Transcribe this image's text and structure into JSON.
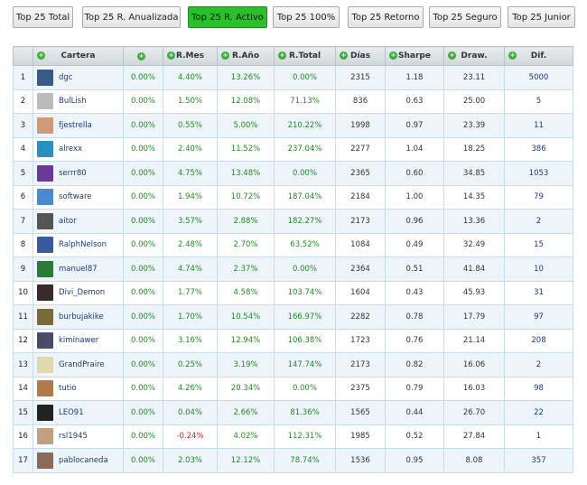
{
  "tabs": [
    {
      "label": "Top 25 Total",
      "active": false
    },
    {
      "label": "Top 25 R. Anualizada",
      "active": false
    },
    {
      "label": "Top 25 R. Activo",
      "active": true
    },
    {
      "label": "Top 25 100%",
      "active": false
    },
    {
      "label": "Top 25 Retorno",
      "active": false
    },
    {
      "label": "Top 25 Seguro",
      "active": false
    },
    {
      "label": "Top 25 Junior",
      "active": false
    }
  ],
  "table": {
    "headers": [
      "",
      "Cartera",
      "",
      "R.Mes",
      "R.Año",
      "R.Total",
      "Días",
      "Sharpe",
      "Draw.",
      "Dif."
    ],
    "sort_icon": "circle-plus-icon",
    "rows": [
      {
        "rank": "1",
        "name": "dgc",
        "c1": "0.00%",
        "rmes": "4.40%",
        "rano": "13.26%",
        "rtotal": "0.00%",
        "dias": "2315",
        "sharpe": "1.18",
        "draw": "23.11",
        "dif": "5000",
        "avatar": "#3a5a8a"
      },
      {
        "rank": "2",
        "name": "BulLish",
        "c1": "0.00%",
        "rmes": "1.50%",
        "rano": "12.08%",
        "rtotal": "71.13%",
        "dias": "836",
        "sharpe": "0.63",
        "draw": "25.00",
        "dif": "5",
        "avatar": "#bbbbbb"
      },
      {
        "rank": "3",
        "name": "fjestrella",
        "c1": "0.00%",
        "rmes": "0.55%",
        "rano": "5.00%",
        "rtotal": "210.22%",
        "dias": "1998",
        "sharpe": "0.97",
        "draw": "23.39",
        "dif": "11",
        "avatar": "#d09a7a"
      },
      {
        "rank": "4",
        "name": "alrexx",
        "c1": "0.00%",
        "rmes": "2.40%",
        "rano": "11.52%",
        "rtotal": "237.04%",
        "dias": "2277",
        "sharpe": "1.04",
        "draw": "18.25",
        "dif": "386",
        "avatar": "#2a90c0"
      },
      {
        "rank": "5",
        "name": "serrr80",
        "c1": "0.00%",
        "rmes": "4.75%",
        "rano": "13.48%",
        "rtotal": "0.00%",
        "dias": "2365",
        "sharpe": "0.60",
        "draw": "34.85",
        "dif": "1053",
        "avatar": "#6a3a9a"
      },
      {
        "rank": "6",
        "name": "software",
        "c1": "0.00%",
        "rmes": "1.94%",
        "rano": "10.72%",
        "rtotal": "187.04%",
        "dias": "2184",
        "sharpe": "1.00",
        "draw": "14.35",
        "dif": "79",
        "avatar": "#4a8ad0"
      },
      {
        "rank": "7",
        "name": "aitor",
        "c1": "0.00%",
        "rmes": "3.57%",
        "rano": "2.88%",
        "rtotal": "182.27%",
        "dias": "2173",
        "sharpe": "0.96",
        "draw": "13.36",
        "dif": "2",
        "avatar": "#555555"
      },
      {
        "rank": "8",
        "name": "RalphNelson",
        "c1": "0.00%",
        "rmes": "2.48%",
        "rano": "2.70%",
        "rtotal": "63.52%",
        "dias": "1084",
        "sharpe": "0.49",
        "draw": "32.49",
        "dif": "15",
        "avatar": "#3a5aa0"
      },
      {
        "rank": "9",
        "name": "manuel87",
        "c1": "0.00%",
        "rmes": "4.74%",
        "rano": "2.37%",
        "rtotal": "0.00%",
        "dias": "2364",
        "sharpe": "0.51",
        "draw": "41.84",
        "dif": "10",
        "avatar": "#2a7a3a"
      },
      {
        "rank": "10",
        "name": "Divi_Demon",
        "c1": "0.00%",
        "rmes": "1.77%",
        "rano": "4.58%",
        "rtotal": "103.74%",
        "dias": "1604",
        "sharpe": "0.43",
        "draw": "45.93",
        "dif": "31",
        "avatar": "#3a2a2a"
      },
      {
        "rank": "11",
        "name": "burbujakike",
        "c1": "0.00%",
        "rmes": "1.70%",
        "rano": "10.54%",
        "rtotal": "166.97%",
        "dias": "2282",
        "sharpe": "0.78",
        "draw": "17.79",
        "dif": "97",
        "avatar": "#7a6a3a"
      },
      {
        "rank": "12",
        "name": "kiminawer",
        "c1": "0.00%",
        "rmes": "3.16%",
        "rano": "12.94%",
        "rtotal": "106.38%",
        "dias": "1723",
        "sharpe": "0.76",
        "draw": "21.14",
        "dif": "208",
        "avatar": "#4a4a6a"
      },
      {
        "rank": "13",
        "name": "GrandPraire",
        "c1": "0.00%",
        "rmes": "0.25%",
        "rano": "3.19%",
        "rtotal": "147.74%",
        "dias": "2173",
        "sharpe": "0.82",
        "draw": "16.06",
        "dif": "2",
        "avatar": "#e0d8b0"
      },
      {
        "rank": "14",
        "name": "tutio",
        "c1": "0.00%",
        "rmes": "4.26%",
        "rano": "20.34%",
        "rtotal": "0.00%",
        "dias": "2375",
        "sharpe": "0.79",
        "draw": "16.03",
        "dif": "98",
        "avatar": "#b07a4a"
      },
      {
        "rank": "15",
        "name": "LEO91",
        "c1": "0.00%",
        "rmes": "0.04%",
        "rano": "2.66%",
        "rtotal": "81.36%",
        "dias": "1565",
        "sharpe": "0.44",
        "draw": "26.70",
        "dif": "22",
        "avatar": "#222222"
      },
      {
        "rank": "16",
        "name": "rsl1945",
        "c1": "0.00%",
        "rmes": "-0.24%",
        "rano": "4.02%",
        "rtotal": "112.31%",
        "dias": "1985",
        "sharpe": "0.52",
        "draw": "27.84",
        "dif": "1",
        "avatar": "#c0a080"
      },
      {
        "rank": "17",
        "name": "pablocaneda",
        "c1": "0.00%",
        "rmes": "2.03%",
        "rano": "12.12%",
        "rtotal": "78.74%",
        "dias": "1536",
        "sharpe": "0.95",
        "draw": "8.08",
        "dif": "357",
        "avatar": "#8a6a5a"
      }
    ]
  }
}
